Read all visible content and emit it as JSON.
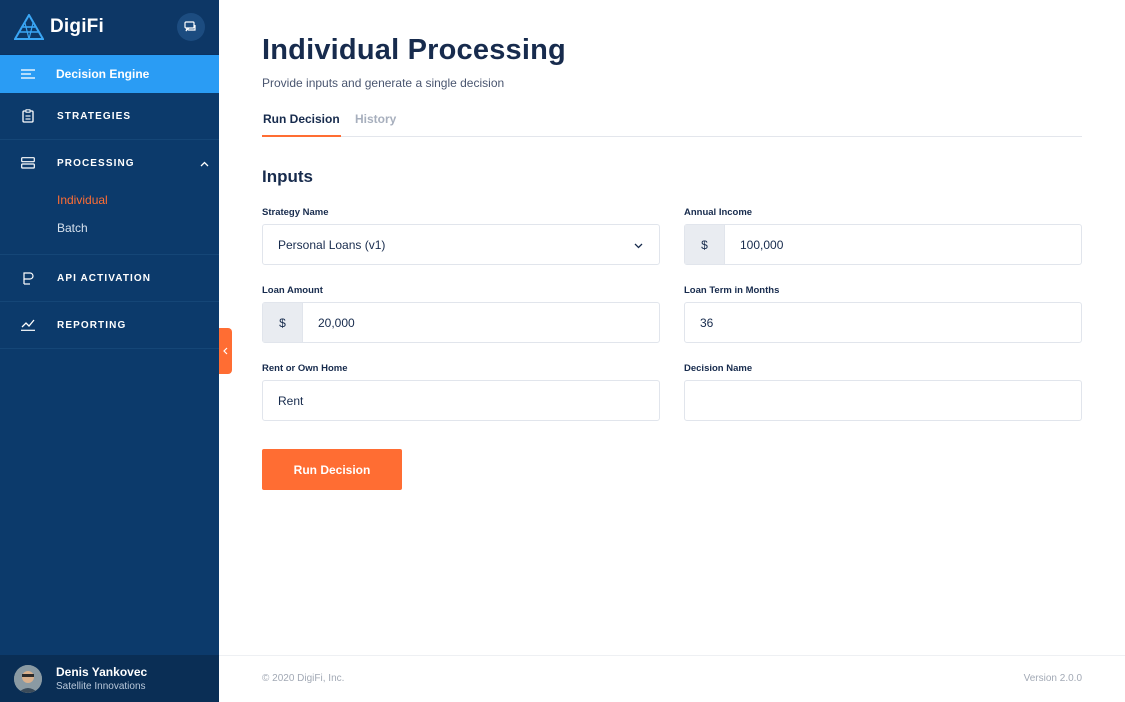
{
  "brand": {
    "name": "DigiFi"
  },
  "sidebar": {
    "active_item": {
      "label": "Decision Engine"
    },
    "items": [
      {
        "label": "STRATEGIES"
      },
      {
        "label": "PROCESSING",
        "children": [
          "Individual",
          "Batch"
        ]
      },
      {
        "label": "API ACTIVATION"
      },
      {
        "label": "REPORTING"
      }
    ]
  },
  "user": {
    "name": "Denis Yankovec",
    "org": "Satellite Innovations"
  },
  "page": {
    "title": "Individual Processing",
    "subtitle": "Provide inputs and generate a single decision",
    "tabs": [
      "Run Decision",
      "History"
    ],
    "section_title": "Inputs"
  },
  "form": {
    "strategy_name": {
      "label": "Strategy Name",
      "value": "Personal Loans (v1)"
    },
    "annual_income": {
      "label": "Annual Income",
      "prefix": "$",
      "value": "100,000"
    },
    "loan_amount": {
      "label": "Loan Amount",
      "prefix": "$",
      "value": "20,000"
    },
    "loan_term": {
      "label": "Loan Term in Months",
      "value": "36"
    },
    "rent_or_own": {
      "label": "Rent or Own Home",
      "value": "Rent"
    },
    "decision_name": {
      "label": "Decision Name",
      "value": ""
    },
    "submit_label": "Run Decision"
  },
  "footer": {
    "copyright": "© 2020 DigiFi, Inc.",
    "version": "Version 2.0.0"
  },
  "colors": {
    "sidebar": "#0c3a6b",
    "active_nav": "#2a9cf4",
    "accent": "#ff6d33"
  }
}
